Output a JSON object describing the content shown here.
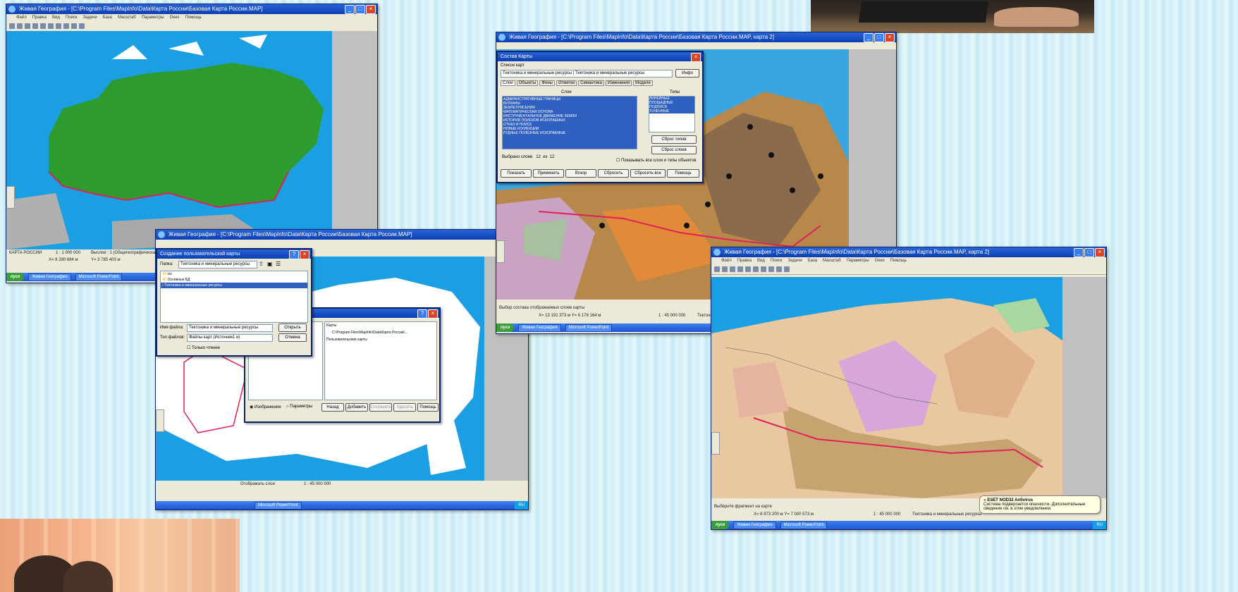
{
  "win1": {
    "title": "Живая География - [C:\\Program Files\\MapInfo\\Data\\Карта России\\Базовая Карта России.MAP]",
    "menu": [
      "Файл",
      "Правка",
      "Вид",
      "Поиск",
      "Задачи",
      "База",
      "Масштаб",
      "Параметры",
      "Окно",
      "Помощь"
    ],
    "status_left": "КАРТА РОССИИ",
    "status_scale": "1 : 1 000 000",
    "status_layer": "Выслое : 1 (Общегеографическая)",
    "status_coords_x": "X= 8 280 684 м",
    "status_coords_y": "Y= 3 785 403 м",
    "taskbar_start": "пуск",
    "taskbar_items": [
      "Живая География",
      "Microsoft PowerPoint"
    ]
  },
  "win2": {
    "title": "Живая География - [C:\\Program Files\\MapInfo\\Data\\Карта России\\Базовая Карта России.MAP]",
    "dialog_title": "Создание пользовательской карты",
    "folder_label": "Папка:",
    "folder_value": "Тектоника и минеральные ресурсы",
    "tree_items": [
      "cis",
      "Основные БД",
      "Тектоника и минеральные ресурсы"
    ],
    "filename_label": "Имя файла:",
    "filename_value": "Тектоника и минеральные ресурсы",
    "filetype_label": "Тип файлов:",
    "filetype_value": "Файлы карт (Источник1 и)",
    "readonly_label": "Только чтение",
    "open_button": "Открыть",
    "cancel_button": "Отмена",
    "inner_title": "...",
    "inner_tree": [
      "Карты",
      "C:\\Program Files\\MapInfo\\Data\\Карта России\\...",
      "Пользовательские карты"
    ],
    "inner_radio1": "Изображение",
    "inner_radio2": "Параметры",
    "inner_buttons": [
      "Назад",
      "Добавить",
      "Сохранить",
      "Удалить",
      "Помощь"
    ],
    "status_scale": "1 : 45 000 000",
    "status_left": "Отображать слои",
    "tray": "RU"
  },
  "win3": {
    "title": "Живая География - [C:\\Program Files\\MapInfo\\Data\\Карта России\\Базовая Карта России.MAP, карта 2]",
    "dialog_title": "Состав Карты",
    "maplist_label": "Список карт",
    "maplist_value1": "Тектоника и минеральные ресурсы",
    "maplist_value2": "Тектоника и минеральные ресурсы",
    "maplist_button": "Инфо",
    "tabs": [
      "Слои",
      "Объекты",
      "Фоны",
      "Отметки",
      "Семантика",
      "Изменения",
      "Модели"
    ],
    "layers_label": "Слои",
    "types_label": "Типы",
    "layers": [
      "АДМИНИСТРАТИВНЫЕ ГРАНИЦЫ",
      "ВУЛКАНЫ",
      "ЗЕМЛЕТРЯСЕНИЯ",
      "МАТЕМАТИЧЕСКАЯ ОСНОВА",
      "ИНСТРУМЕНТАЛЬНОЕ ДВИЖЕНИЕ ЗЕМЛИ",
      "ИСТОРИЯ ПОИСКОВ ИСКОПАЕМЫХ",
      "ОТКАЗ И ПОИСК",
      "НОВЫЕ КОЛЛЕКЦИИ",
      "РУДНЫЕ ПОЛЕЗНЫЕ ИСКОПАЕМЫЕ"
    ],
    "types": [
      "ЛИНЕЙНЫЕ",
      "ПЛОЩАДНЫЕ",
      "ПОДПИСИ",
      "ТОЧЕЧНЫЕ"
    ],
    "selected_label": "Выбрано слоев",
    "selected_count": "12",
    "of_label": "из",
    "total_count": "12",
    "btn_reset_types": "Сброс типов",
    "btn_reset_layers": "Сброс слоев",
    "checkbox_label": "Показывать все слои и типы объектов",
    "bottom_buttons": [
      "Показать",
      "Применить",
      "Вгнор",
      "Сбросить",
      "Сбросить все",
      "Помощь"
    ],
    "status_text": "Выбор состава отображаемых слоев карты",
    "status_coords": "X= 13 191 373 м   Y= 6 178 164 м",
    "status_scale": "1 : 45 000 000",
    "status_right": "Тектоника",
    "taskbar_start": "пуск",
    "taskbar_items": [
      "Живая География",
      "Microsoft PowerPoint"
    ]
  },
  "win4": {
    "title": "Живая География - [C:\\Program Files\\MapInfo\\Data\\Карта России\\Базовая Карта России.MAP, карта 2]",
    "menu": [
      "Файл",
      "Правка",
      "Вид",
      "Поиск",
      "Задачи",
      "База",
      "Масштаб",
      "Параметры",
      "Окно",
      "Помощь"
    ],
    "status_text": "Выберите фрагмент на карте",
    "status_coords": "X= 6 973 200 м   Y= 7 000 573 м",
    "status_scale": "1 : 45 000 000",
    "status_right": "Тектоника и минеральные ресурсы",
    "tooltip_title": "ESET NOD32 Antivirus",
    "tooltip_text": "Система подвергается опасности. Дополнительные сведения см. в этом уведомлении.",
    "taskbar_start": "пуск",
    "taskbar_items": [
      "Живая География",
      "Microsoft PowerPoint"
    ],
    "tray": "RU"
  },
  "colors": {
    "ocean": "#1a9fe2",
    "land_green": "#2e9b2e",
    "land_brown": "#b8874a",
    "land_tan": "#e9c7a0",
    "land_pink": "#d8a6d8",
    "border_red": "#e0205a",
    "titlebar": "#0a3fb0"
  }
}
